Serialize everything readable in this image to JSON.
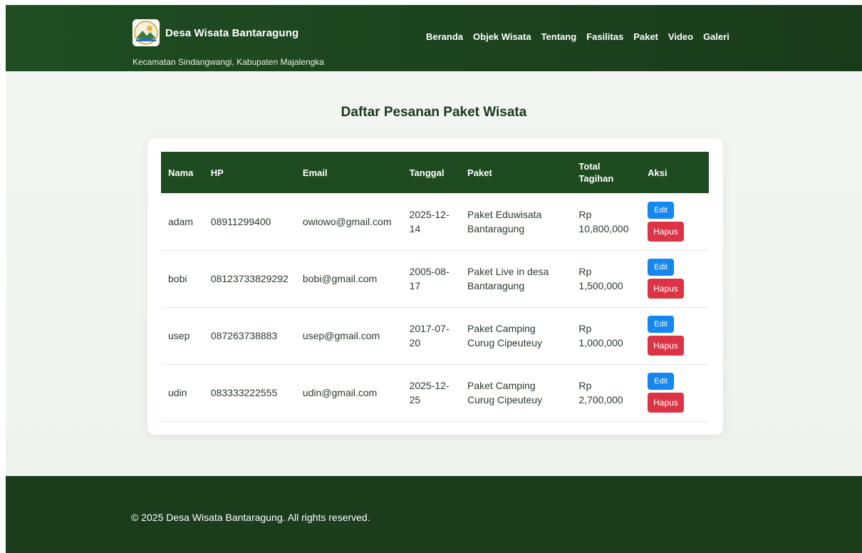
{
  "header": {
    "title": "Desa Wisata Bantaragung",
    "subtitle": "Kecamatan Sindangwangi, Kabupaten Majalengka",
    "nav": [
      "Beranda",
      "Objek Wisata",
      "Tentang",
      "Fasilitas",
      "Paket",
      "Video",
      "Galeri"
    ]
  },
  "main": {
    "title": "Daftar Pesanan Paket Wisata",
    "columns": [
      "Nama",
      "HP",
      "Email",
      "Tanggal",
      "Paket",
      "Total Tagihan",
      "Aksi"
    ],
    "edit_label": "Edit",
    "delete_label": "Hapus",
    "rows": [
      {
        "nama": "adam",
        "hp": "08911299400",
        "email": "owiowo@gmail.com",
        "tanggal": "2025-12-14",
        "paket": "Paket Eduwisata Bantaragung",
        "total": "Rp 10,800,000"
      },
      {
        "nama": "bobi",
        "hp": "08123733829292",
        "email": "bobi@gmail.com",
        "tanggal": "2005-08-17",
        "paket": "Paket Live in desa Bantaragung",
        "total": "Rp 1,500,000"
      },
      {
        "nama": "usep",
        "hp": "087263738883",
        "email": "usep@gmail.com",
        "tanggal": "2017-07-20",
        "paket": "Paket Camping Curug Cipeuteuy",
        "total": "Rp 1,000,000"
      },
      {
        "nama": "udin",
        "hp": "083333222555",
        "email": "udin@gmail.com",
        "tanggal": "2025-12-25",
        "paket": "Paket Camping Curug Cipeuteuy",
        "total": "Rp 2,700,000"
      }
    ]
  },
  "footer": {
    "copyright": "© 2025 Desa Wisata Bantaragung. All rights reserved."
  },
  "colors": {
    "header_bg": "#1f4d22",
    "edit_button": "#1487f0",
    "delete_button": "#dc3345"
  }
}
